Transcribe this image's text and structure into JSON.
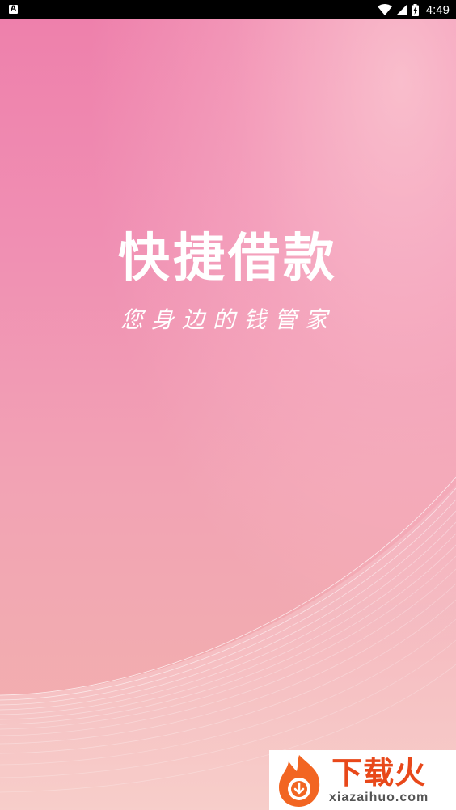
{
  "status_bar": {
    "app_icon_letter": "A",
    "time": "4:49",
    "icons": [
      "wifi-icon",
      "signal-icon",
      "battery-charging-icon"
    ]
  },
  "splash": {
    "title": "快捷借款",
    "subtitle": "您身边的钱管家"
  },
  "watermark": {
    "brand": "下载火",
    "domain": "xiazaihuo.com"
  },
  "colors": {
    "background_top": "#ee7fab",
    "background_bottom": "#f3b3ad",
    "text": "#ffffff",
    "watermark_brand": "#e8481a"
  }
}
